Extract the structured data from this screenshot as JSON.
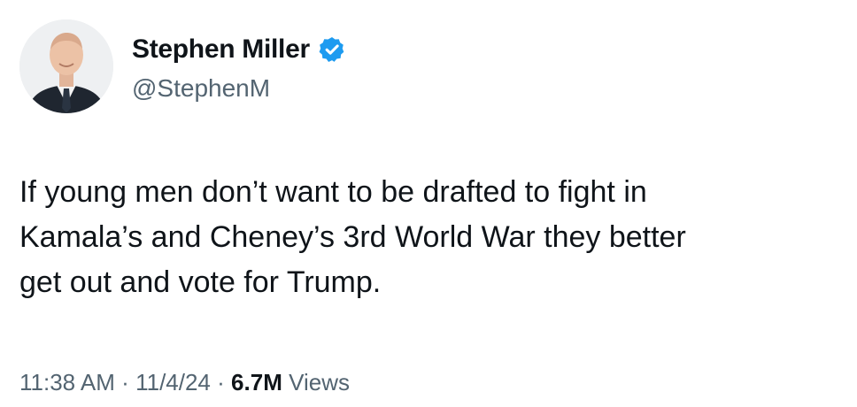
{
  "author": {
    "display_name": "Stephen Miller",
    "handle": "@StephenM",
    "verified": true,
    "avatar_icon": "profile-photo"
  },
  "tweet": {
    "text": "If young men don’t want to be drafted to fight in\nKamala’s and Cheney’s 3rd World War they better\nget out and vote for Trump."
  },
  "meta": {
    "time": "11:38 AM",
    "separator": "·",
    "date": "11/4/24",
    "views_count": "6.7M",
    "views_label": "Views"
  },
  "colors": {
    "verified_badge": "#1d9bf0",
    "primary_text": "#0f1419",
    "secondary_text": "#536471"
  }
}
